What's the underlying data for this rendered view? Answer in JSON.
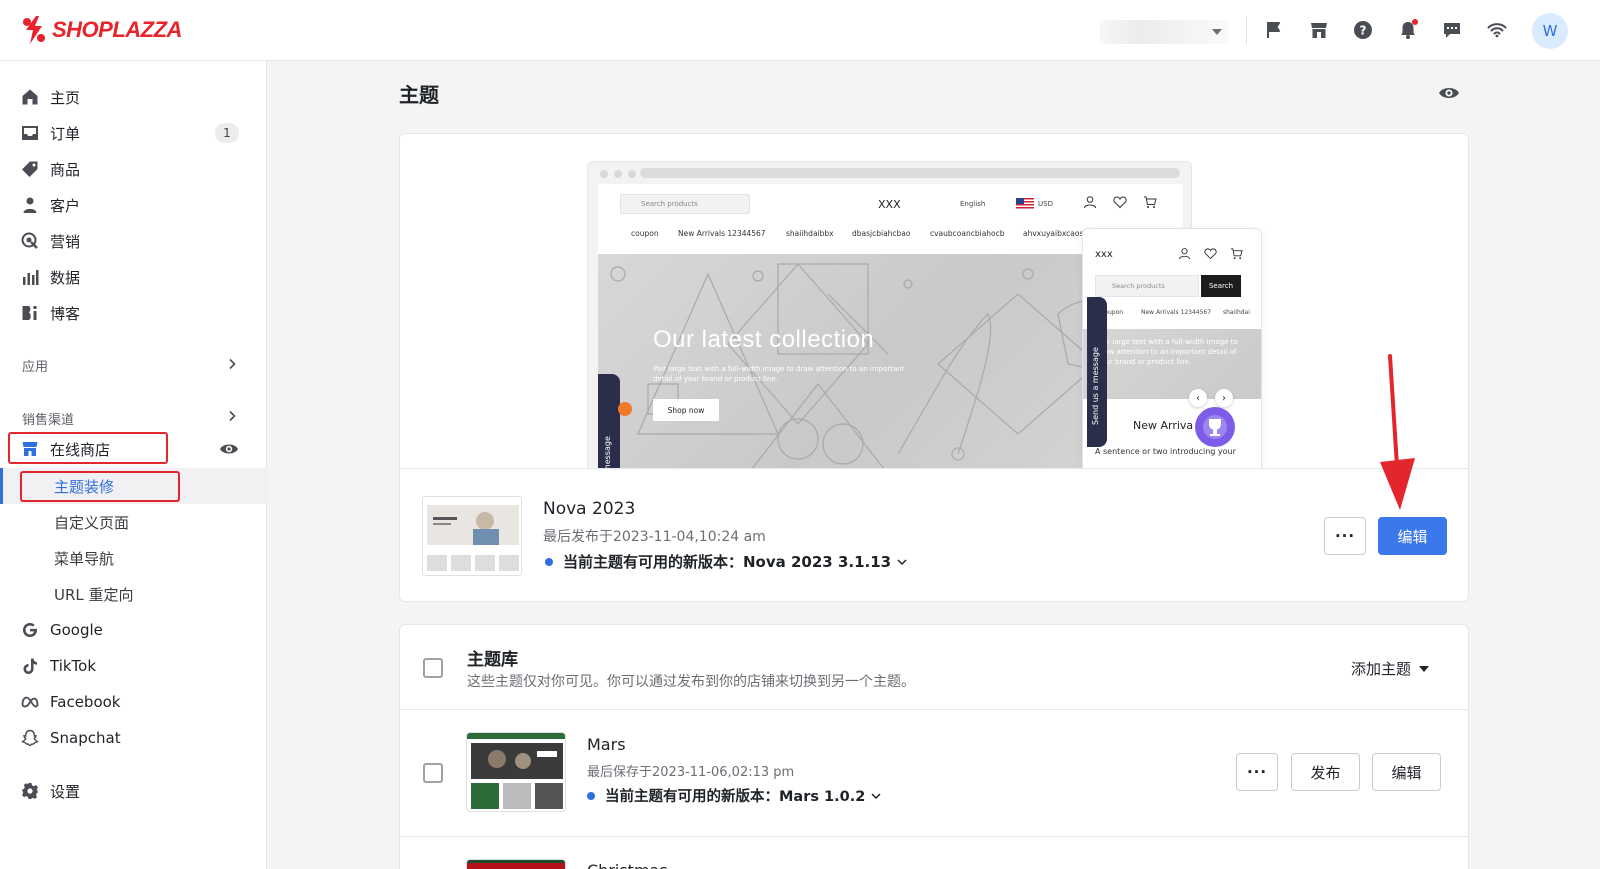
{
  "header": {
    "logo_text": "SHOPLAZZA",
    "avatar_initial": "W",
    "brand_color": "#e8232c",
    "icons": [
      "flag-icon",
      "store-icon",
      "help-icon",
      "bell-icon",
      "chat-icon",
      "wifi-icon"
    ]
  },
  "sidebar": {
    "items": [
      {
        "label": "主页",
        "icon": "home-icon"
      },
      {
        "label": "订单",
        "icon": "inbox-icon",
        "badge": "1"
      },
      {
        "label": "商品",
        "icon": "tag-icon"
      },
      {
        "label": "客户",
        "icon": "user-icon"
      },
      {
        "label": "营销",
        "icon": "marketing-icon"
      },
      {
        "label": "数据",
        "icon": "chart-icon"
      },
      {
        "label": "博客",
        "icon": "blog-icon"
      }
    ],
    "apps_label": "应用",
    "channels_label": "销售渠道",
    "online_store": {
      "label": "在线商店",
      "sub_items": [
        "主题装修",
        "自定义页面",
        "菜单导航",
        "URL 重定向"
      ],
      "active_sub": "主题装修"
    },
    "channels": [
      {
        "label": "Google",
        "icon": "google-icon"
      },
      {
        "label": "TikTok",
        "icon": "tiktok-icon"
      },
      {
        "label": "Facebook",
        "icon": "meta-icon"
      },
      {
        "label": "Snapchat",
        "icon": "snapchat-icon"
      }
    ],
    "settings_label": "设置"
  },
  "main": {
    "title": "主题",
    "preview": {
      "search_placeholder": "Search products",
      "brand": "XXX",
      "language": "English",
      "currency": "USD",
      "nav": [
        "coupon",
        "New Arrivals 12344567",
        "shaiihdaibbx",
        "dbasjcbiahcbao",
        "cvaubcoancbiahocb",
        "ahvxuyaibxcaos"
      ],
      "hero_title": "Our latest collection",
      "hero_sub": "Pair large text with a full-width image to draw attention to an important detail of your brand or product line.",
      "hero_button": "Shop now",
      "chat_tab": "Send us a message",
      "mobile_brand": "xxx",
      "mobile_search_placeholder": "Search products",
      "mobile_search_button": "Search",
      "mobile_tags": [
        "coupon",
        "New Arrivals 12344567",
        "shaiihdai"
      ],
      "mobile_hero_sub": "Pair large text with a full-width image to draw attention to an important detail of your brand or product line.",
      "mobile_arrivals": "New Arriva",
      "mobile_intro": "A sentence or two introducing your"
    },
    "current_theme": {
      "name": "Nova 2023",
      "published": "最后发布于2023-11-04,10:24 am",
      "update_notice": "当前主题有可用的新版本：Nova 2023 3.1.13",
      "more_label": "···",
      "edit_label": "编辑"
    },
    "library": {
      "title": "主题库",
      "description": "这些主题仅对你可见。你可以通过发布到你的店铺来切换到另一个主题。",
      "add_label": "添加主题",
      "themes": [
        {
          "name": "Mars",
          "saved": "最后保存于2023-11-06,02:13 pm",
          "update_notice": "当前主题有可用的新版本：Mars 1.0.2",
          "more_label": "···",
          "publish_label": "发布",
          "edit_label": "编辑"
        },
        {
          "name": "Christmas"
        }
      ]
    }
  },
  "colors": {
    "accent": "#3a78ec",
    "highlight_box": "#e3262e",
    "active_nav": "#2f6fe0"
  }
}
